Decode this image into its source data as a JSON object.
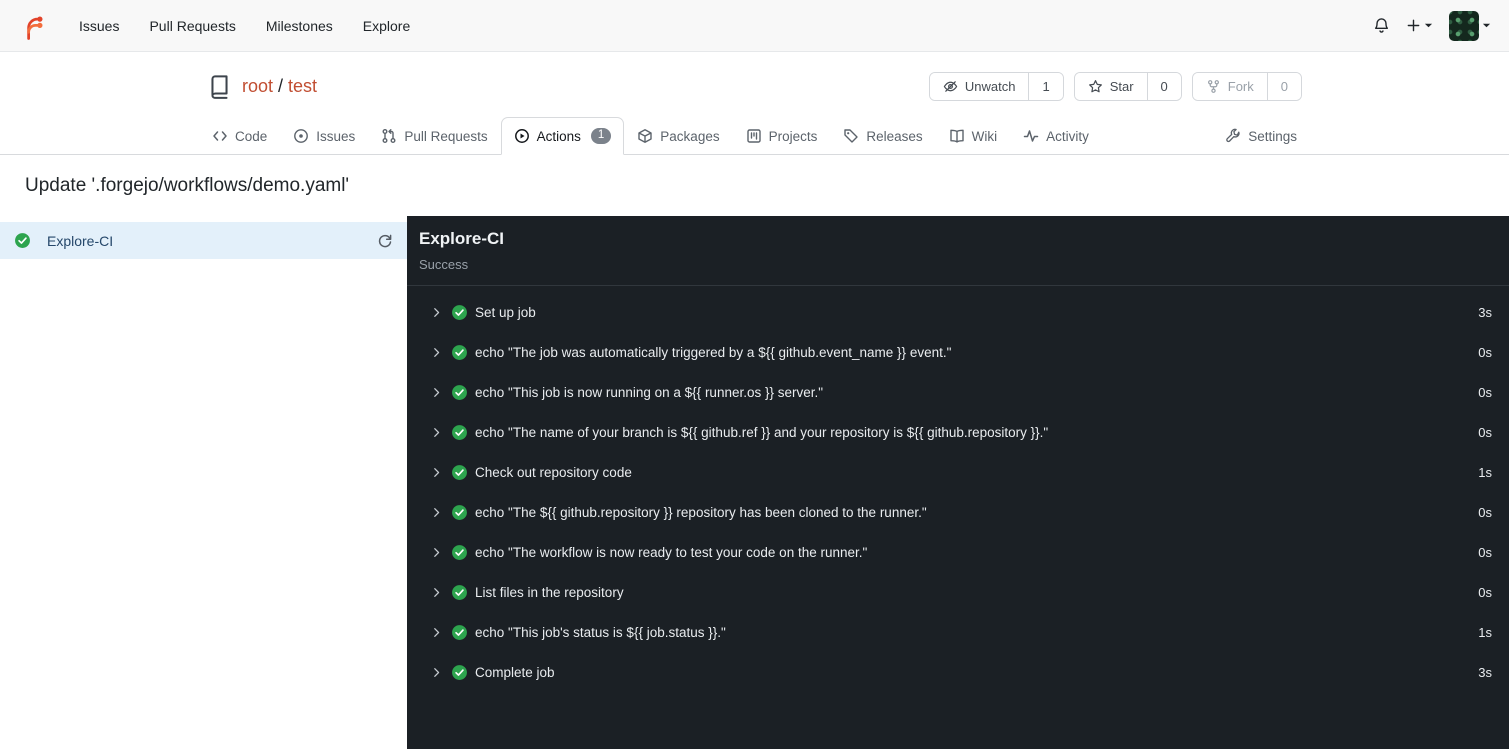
{
  "colors": {
    "accent_orange": "#c14e32",
    "success_green": "#2da44e",
    "dark_panel_bg": "#1b2025",
    "selected_job_bg": "#e3f0fa"
  },
  "navbar": {
    "items": [
      {
        "label": "Issues"
      },
      {
        "label": "Pull Requests"
      },
      {
        "label": "Milestones"
      },
      {
        "label": "Explore"
      }
    ],
    "right_icons": [
      "bell-icon",
      "plus-icon",
      "caret-down-icon",
      "user-avatar",
      "caret-down-icon"
    ]
  },
  "repo": {
    "owner": "root",
    "separator": "/",
    "name": "test",
    "header_buttons": {
      "unwatch": {
        "label": "Unwatch",
        "count": "1",
        "icon": "eye-off-icon"
      },
      "star": {
        "label": "Star",
        "count": "0",
        "icon": "star-icon"
      },
      "fork": {
        "label": "Fork",
        "count": "0",
        "icon": "fork-icon"
      }
    },
    "tabs": [
      {
        "label": "Code",
        "icon": "code-icon"
      },
      {
        "label": "Issues",
        "icon": "issue-icon"
      },
      {
        "label": "Pull Requests",
        "icon": "pull-request-icon"
      },
      {
        "label": "Actions",
        "icon": "play-circle-icon",
        "badge": "1",
        "active": true
      },
      {
        "label": "Packages",
        "icon": "package-icon"
      },
      {
        "label": "Projects",
        "icon": "project-icon"
      },
      {
        "label": "Releases",
        "icon": "tag-icon"
      },
      {
        "label": "Wiki",
        "icon": "book-icon"
      },
      {
        "label": "Activity",
        "icon": "pulse-icon"
      },
      {
        "label": "Settings",
        "icon": "wrench-icon"
      }
    ]
  },
  "page": {
    "title": "Update '.forgejo/workflows/demo.yaml'"
  },
  "jobs_sidebar": {
    "items": [
      {
        "name": "Explore-CI",
        "status": "success",
        "selected": true
      }
    ]
  },
  "run": {
    "title": "Explore-CI",
    "status": "Success",
    "steps": [
      {
        "name": "Set up job",
        "duration": "3s"
      },
      {
        "name": "echo \"The job was automatically triggered by a ${{ github.event_name }} event.\"",
        "duration": "0s"
      },
      {
        "name": "echo \"This job is now running on a ${{ runner.os }} server.\"",
        "duration": "0s"
      },
      {
        "name": "echo \"The name of your branch is ${{ github.ref }} and your repository is ${{ github.repository }}.\"",
        "duration": "0s"
      },
      {
        "name": "Check out repository code",
        "duration": "1s"
      },
      {
        "name": "echo \"The ${{ github.repository }} repository has been cloned to the runner.\"",
        "duration": "0s"
      },
      {
        "name": "echo \"The workflow is now ready to test your code on the runner.\"",
        "duration": "0s"
      },
      {
        "name": "List files in the repository",
        "duration": "0s"
      },
      {
        "name": "echo \"This job's status is ${{ job.status }}.\"",
        "duration": "1s"
      },
      {
        "name": "Complete job",
        "duration": "3s"
      }
    ]
  }
}
